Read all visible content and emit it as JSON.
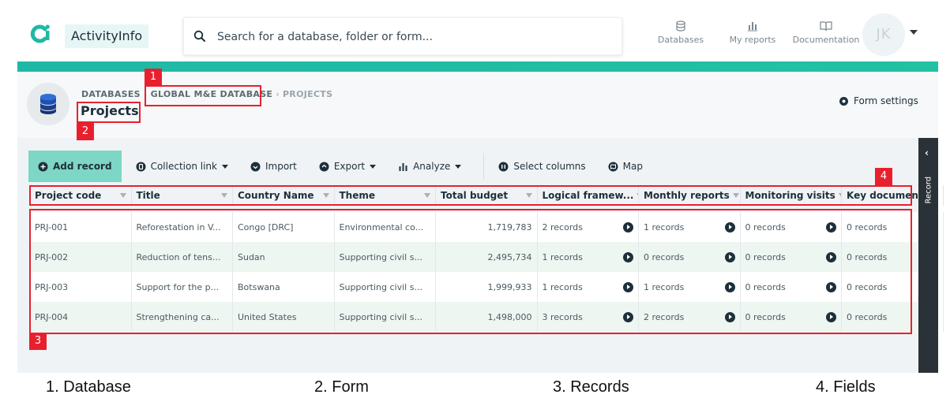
{
  "header": {
    "brand": "ActivityInfo",
    "search_placeholder": "Search for a database, folder or form...",
    "nav": [
      {
        "label": "Databases",
        "icon": "database-icon"
      },
      {
        "label": "My reports",
        "icon": "bar-chart-icon"
      },
      {
        "label": "Documentation",
        "icon": "book-icon"
      }
    ],
    "avatar_initials": "JK"
  },
  "breadcrumb": {
    "items": [
      "DATABASES",
      "GLOBAL M&E DATABASE",
      "PROJECTS"
    ]
  },
  "page": {
    "title": "Projects",
    "form_settings": "Form settings"
  },
  "toolbar": {
    "add_record": "Add record",
    "collection_link": "Collection link",
    "import": "Import",
    "export": "Export",
    "analyze": "Analyze",
    "select_columns": "Select columns",
    "map": "Map"
  },
  "table": {
    "columns": [
      "Project code",
      "Title",
      "Country Name",
      "Theme",
      "Total budget",
      "Logical framew...",
      "Monthly reports",
      "Monitoring visits",
      "Key documents"
    ],
    "rows": [
      [
        "PRJ-001",
        "Reforestation in V...",
        "Congo [DRC]",
        "Environmental co...",
        "1,719,783",
        "2 records",
        "1 records",
        "0 records",
        "0 records"
      ],
      [
        "PRJ-002",
        "Reduction of tens...",
        "Sudan",
        "Supporting civil s...",
        "2,495,734",
        "1 records",
        "0 records",
        "0 records",
        "0 records"
      ],
      [
        "PRJ-003",
        "Support for the p...",
        "Botswana",
        "Supporting civil s...",
        "1,999,933",
        "1 records",
        "1 records",
        "0 records",
        "0 records"
      ],
      [
        "PRJ-004",
        "Strengthening ca...",
        "United States",
        "Supporting civil s...",
        "1,498,000",
        "3 records",
        "2 records",
        "0 records",
        "0 records"
      ]
    ]
  },
  "side_panel": {
    "label": "Record"
  },
  "annotations": {
    "tags": [
      "1",
      "2",
      "3",
      "4"
    ],
    "captions": [
      "1. Database",
      "2. Form",
      "3. Records",
      "4. Fields"
    ]
  },
  "colors": {
    "accent": "#1fb8a6",
    "add_button": "#7ed6c5",
    "annotation": "#e8202e",
    "side_panel": "#2a3237"
  }
}
